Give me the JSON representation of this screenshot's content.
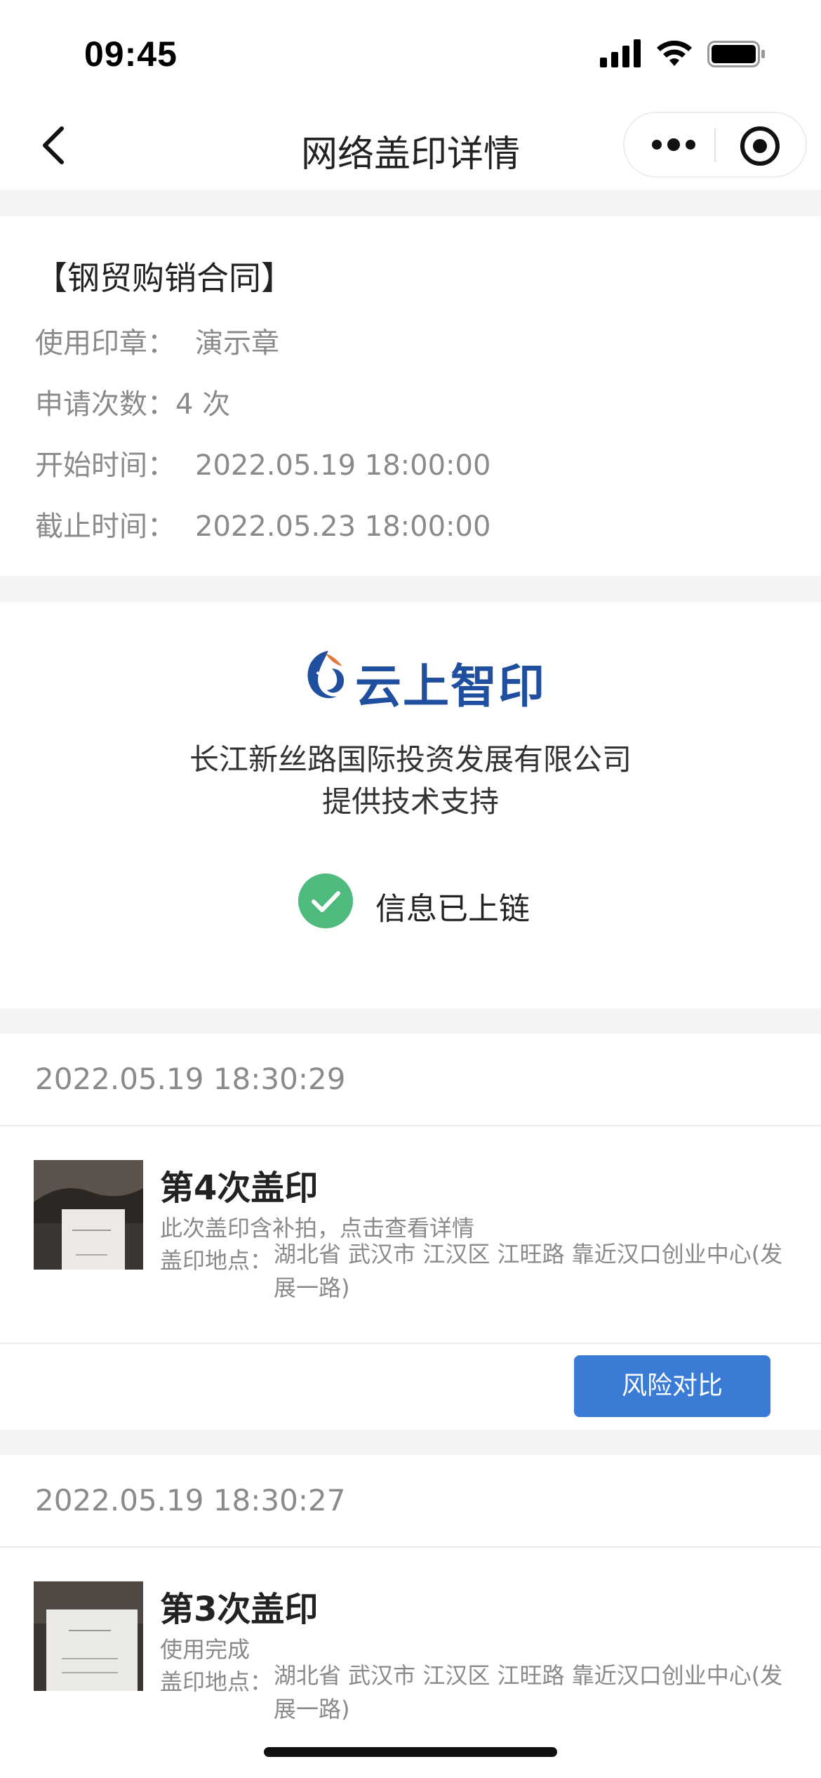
{
  "status_bar": {
    "time": "09:45"
  },
  "nav": {
    "title": "网络盖印详情"
  },
  "contract": {
    "title": "【钢贸购销合同】",
    "rows": [
      {
        "label": "使用印章：",
        "value": "演示章"
      },
      {
        "label": "申请次数：",
        "value": "4 次"
      },
      {
        "label": "开始时间：",
        "value": "2022.05.19 18:00:00"
      },
      {
        "label": "截止时间：",
        "value": "2022.05.23 18:00:00"
      }
    ]
  },
  "brand": {
    "logo_text": "云上智印",
    "company": "长江新丝路国际投资发展有限公司",
    "support": "提供技术支持",
    "chain_status": "信息已上链",
    "accent_color": "#1f4f9e",
    "check_color": "#4fba7e"
  },
  "records": [
    {
      "datetime": "2022.05.19 18:30:29",
      "title": "第4次盖印",
      "note": "此次盖印含补拍，点击查看详情",
      "location_label": "盖印地点：",
      "location": "湖北省 武汉市 江汉区 江旺路 靠近汉口创业中心(发展一路)",
      "action": "风险对比"
    },
    {
      "datetime": "2022.05.19 18:30:27",
      "title": "第3次盖印",
      "note": "使用完成",
      "location_label": "盖印地点：",
      "location": "湖北省 武汉市 江汉区 江旺路 靠近汉口创业中心(发展一路)"
    }
  ],
  "button_color": "#3a7bd5"
}
